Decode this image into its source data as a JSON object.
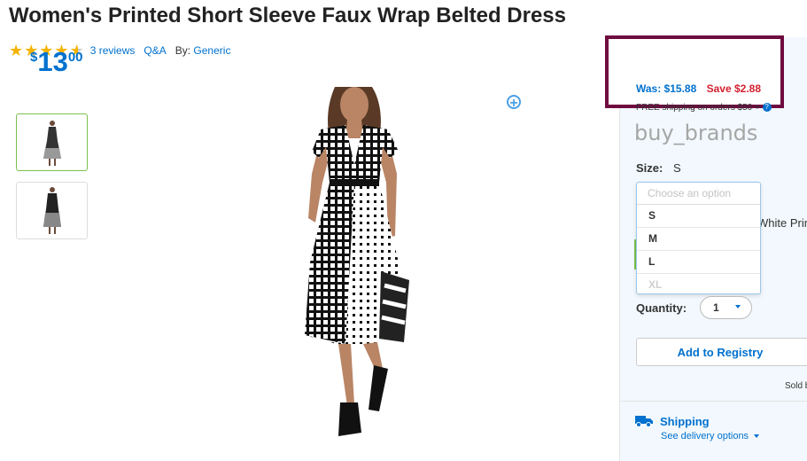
{
  "product": {
    "title": "Women's Printed Short Sleeve Faux Wrap Belted Dress",
    "rating": 4.5,
    "reviews": "3 reviews",
    "qa": "Q&A",
    "by_label": "By:",
    "brand_link": "Generic"
  },
  "price": {
    "currency": "$",
    "dollars": "13",
    "cents": "00",
    "was": "Was: $15.88",
    "save": "Save $2.88",
    "shipping_note": "FREE shipping on orders $50 +",
    "highlight_color": "#6f0b3f"
  },
  "brand_text": "buy_brands",
  "size": {
    "label": "Size:",
    "value": "S",
    "placeholder": "Choose an option",
    "options": [
      "S",
      "M",
      "L",
      "XL"
    ]
  },
  "partial_text": "White Print",
  "quantity": {
    "label": "Quantity:",
    "value": "1"
  },
  "buttons": {
    "registry": "Add to Registry"
  },
  "sold_by": "Sold b",
  "shipping": {
    "title": "Shipping",
    "delivery_link": "See delivery options"
  },
  "colors": {
    "accent": "#0071ce",
    "save": "#d41f2e",
    "star": "#f4b400",
    "selected_thumb": "#7bc24f"
  }
}
